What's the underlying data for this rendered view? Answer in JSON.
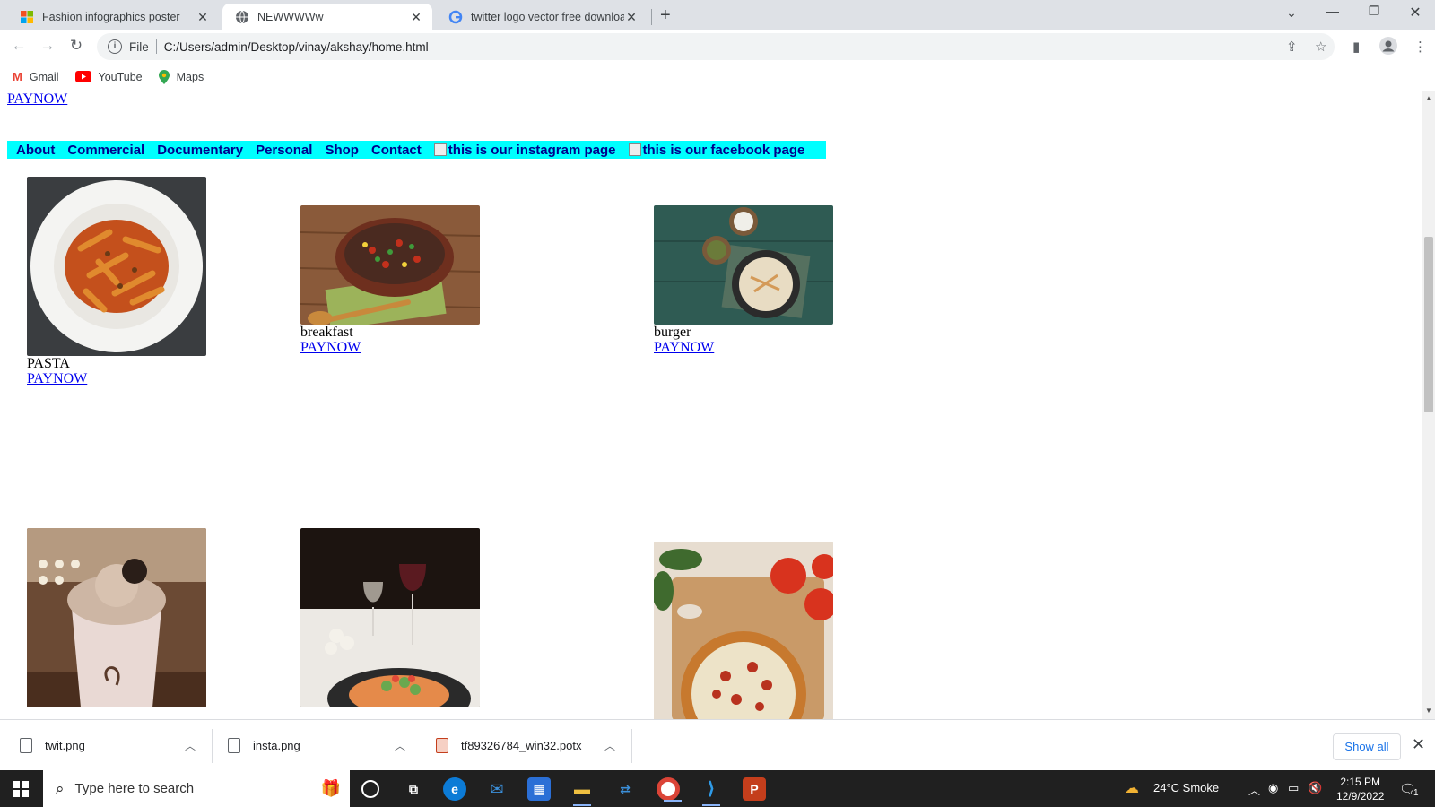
{
  "browser": {
    "tabs": [
      {
        "title": "Fashion infographics poster",
        "icon": "microsoft-icon"
      },
      {
        "title": "NEWWWWw",
        "icon": "globe-icon"
      },
      {
        "title": "twitter logo vector free downloa",
        "icon": "google-icon"
      }
    ],
    "address": {
      "scheme": "File",
      "url": "C:/Users/admin/Desktop/vinay/akshay/home.html"
    },
    "bookmarks": [
      {
        "label": "Gmail",
        "icon": "gmail-icon"
      },
      {
        "label": "YouTube",
        "icon": "youtube-icon"
      },
      {
        "label": "Maps",
        "icon": "maps-icon"
      }
    ]
  },
  "page": {
    "top_link": "PAYNOW",
    "nav": {
      "links": [
        "About",
        "Commercial",
        "Documentary",
        "Personal",
        "Shop",
        "Contact"
      ],
      "image_alts": [
        "this is our instagram page",
        "this is our facebook page"
      ],
      "background": "#00ffff"
    },
    "items": [
      {
        "caption": "PASTA",
        "link": "PAYNOW"
      },
      {
        "caption": "breakfast",
        "link": "PAYNOW"
      },
      {
        "caption": "burger",
        "link": "PAYNOW"
      },
      {
        "caption": "",
        "link": ""
      },
      {
        "caption": "",
        "link": ""
      },
      {
        "caption": "",
        "link": ""
      }
    ]
  },
  "downloads": {
    "files": [
      {
        "name": "twit.png",
        "icon": "image-file-icon"
      },
      {
        "name": "insta.png",
        "icon": "image-file-icon"
      },
      {
        "name": "tf89326784_win32.potx",
        "icon": "powerpoint-file-icon"
      }
    ],
    "show_all": "Show all"
  },
  "taskbar": {
    "search_placeholder": "Type here to search",
    "weather": "24°C  Smoke",
    "time": "2:15 PM",
    "date": "12/9/2022",
    "notifications": "1"
  }
}
